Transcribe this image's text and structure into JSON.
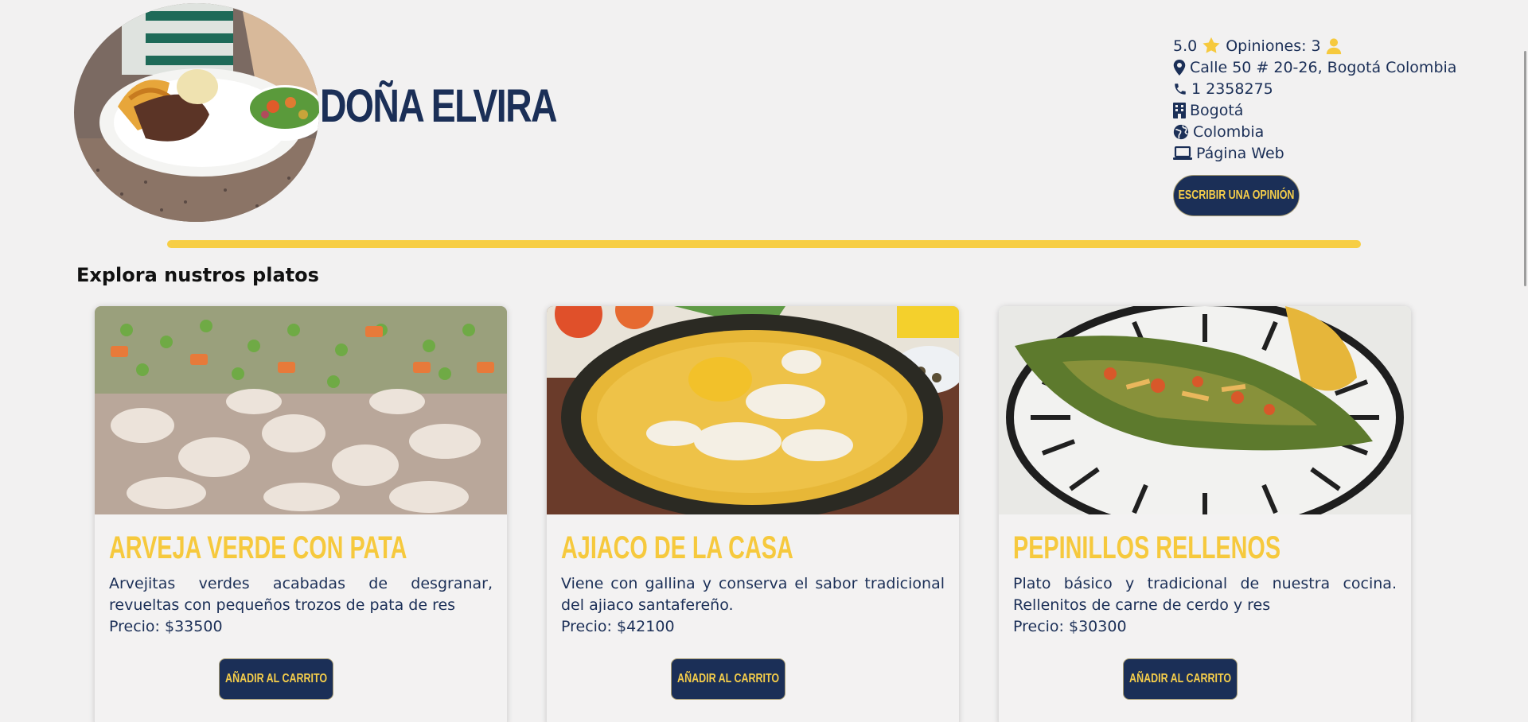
{
  "restaurant": {
    "name": "DOÑA ELVIRA",
    "rating": "5.0",
    "reviews_label": "Opiniones: 3",
    "address": "Calle 50 # 20-26, Bogotá Colombia",
    "phone": "1 2358275",
    "city": "Bogotá",
    "country": "Colombia",
    "website_label": "Página Web",
    "review_button": "ESCRIBIR UNA OPINIÓN"
  },
  "section_title": "Explora nustros platos",
  "dishes": [
    {
      "name": "ARVEJA VERDE CON PATA",
      "description": "Arvejitas verdes acabadas de desgranar, revueltas con pequeños trozos de pata de res",
      "price": "Precio: $33500",
      "button": "AÑADIR AL CARRITO"
    },
    {
      "name": "AJIACO DE LA CASA",
      "description": "Viene con gallina y conserva el sabor tradicional del ajiaco santafereño.",
      "price": "Precio: $42100",
      "button": "AÑADIR AL CARRITO"
    },
    {
      "name": "PEPINILLOS RELLENOS",
      "description": "Plato básico y tradicional de nuestra cocina. Rellenitos de carne de cerdo y res",
      "price": "Precio: $30300",
      "button": "AÑADIR AL CARRITO"
    }
  ],
  "icons": {
    "rating": "star-icon",
    "reviews": "user-icon",
    "address": "map-pin-icon",
    "phone": "phone-icon",
    "city": "building-icon",
    "country": "globe-icon",
    "website": "laptop-icon"
  },
  "colors": {
    "navy": "#1b2f57",
    "gold": "#f6c93d",
    "background": "#f2f1f1"
  }
}
